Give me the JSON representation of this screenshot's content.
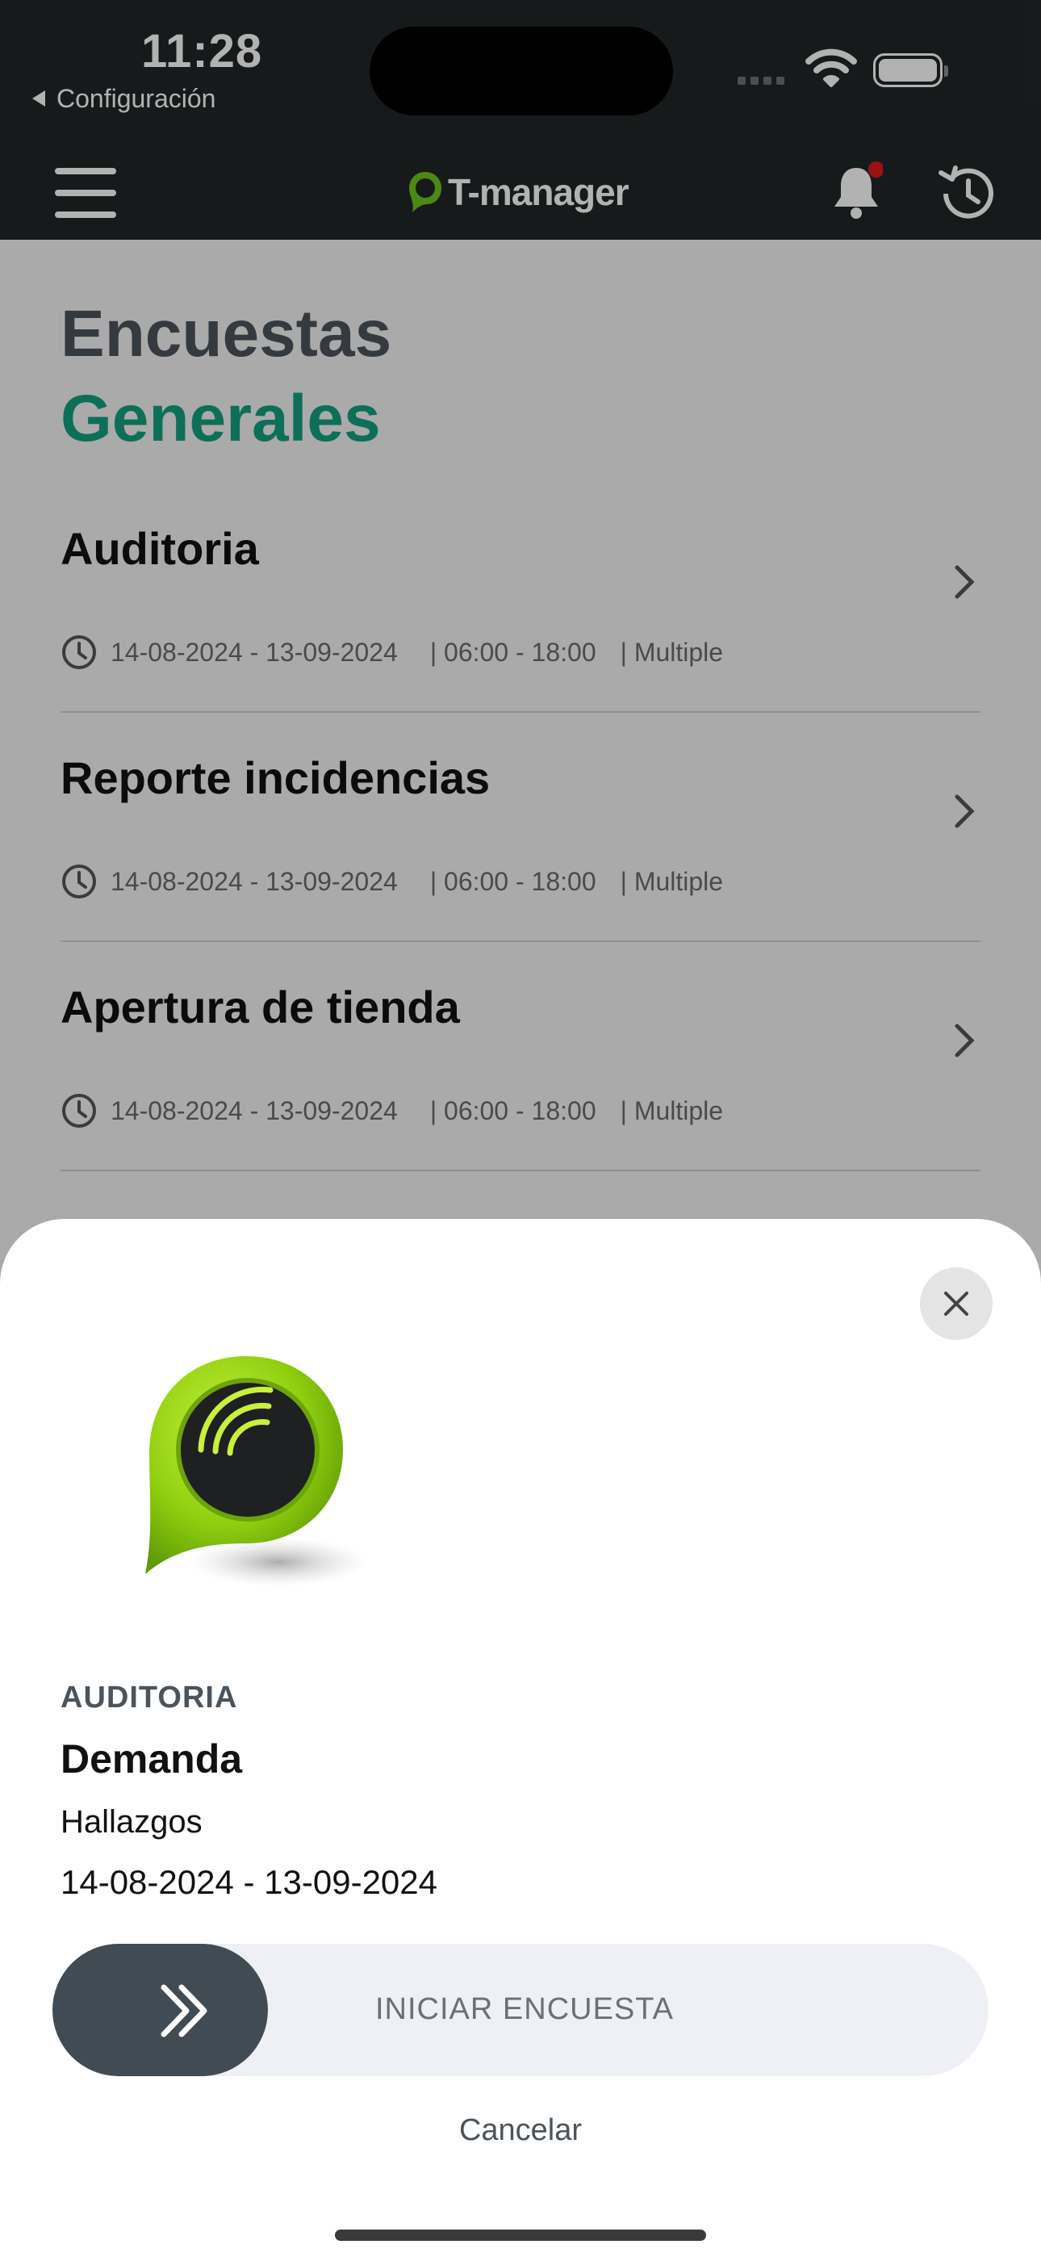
{
  "status_bar": {
    "time": "11:28",
    "back_label": "Configuración"
  },
  "app": {
    "name": "T-manager",
    "brand_color": "#14a07f",
    "notification_dot": true
  },
  "page": {
    "title_line1": "Encuestas",
    "title_line2": "Generales"
  },
  "surveys": [
    {
      "name": "Auditoria",
      "dates": "14-08-2024 - 13-09-2024",
      "hours": "| 06:00 - 18:00",
      "mode": "| Multiple"
    },
    {
      "name": "Reporte incidencias",
      "dates": "14-08-2024 - 13-09-2024",
      "hours": "| 06:00 - 18:00",
      "mode": "| Multiple"
    },
    {
      "name": "Apertura de tienda",
      "dates": "14-08-2024 - 13-09-2024",
      "hours": "| 06:00 - 18:00",
      "mode": "| Multiple"
    }
  ],
  "sheet": {
    "category": "AUDITORIA",
    "name": "Demanda",
    "subtitle": "Hallazgos",
    "dates": "14-08-2024 - 13-09-2024",
    "slider_label": "INICIAR ENCUESTA",
    "cancel_label": "Cancelar"
  }
}
